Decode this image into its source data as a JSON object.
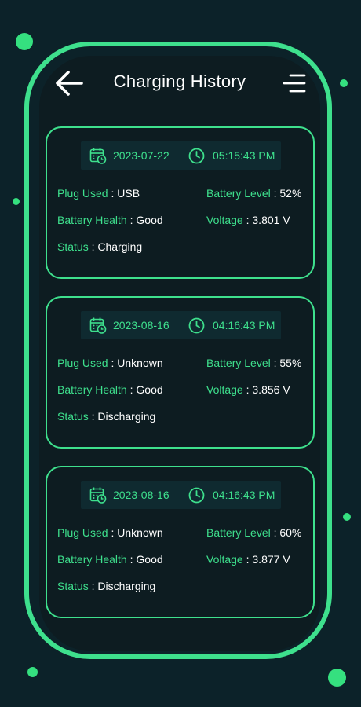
{
  "header": {
    "title": "Charging History",
    "back_icon": "arrow-left-icon",
    "menu_icon": "menu-icon"
  },
  "labels": {
    "plug_used": "Plug Used",
    "battery_level": "Battery Level",
    "battery_health": "Battery Health",
    "voltage": "Voltage",
    "status": "Status",
    "separator": " : "
  },
  "records": [
    {
      "date": "2023-07-22",
      "time": "05:15:43 PM",
      "plug_used": "USB",
      "battery_level": "52%",
      "battery_health": "Good",
      "voltage": "3.801 V",
      "status": "Charging"
    },
    {
      "date": "2023-08-16",
      "time": "04:16:43 PM",
      "plug_used": "Unknown",
      "battery_level": "55%",
      "battery_health": "Good",
      "voltage": "3.856 V",
      "status": "Discharging"
    },
    {
      "date": "2023-08-16",
      "time": "04:16:43 PM",
      "plug_used": "Unknown",
      "battery_level": "60%",
      "battery_health": "Good",
      "voltage": "3.877 V",
      "status": "Discharging"
    }
  ],
  "colors": {
    "accent": "#3ee08d",
    "background": "#0c2229",
    "panel": "#0d1c21",
    "date_bar": "#0f2a30",
    "text": "#ffffff"
  }
}
